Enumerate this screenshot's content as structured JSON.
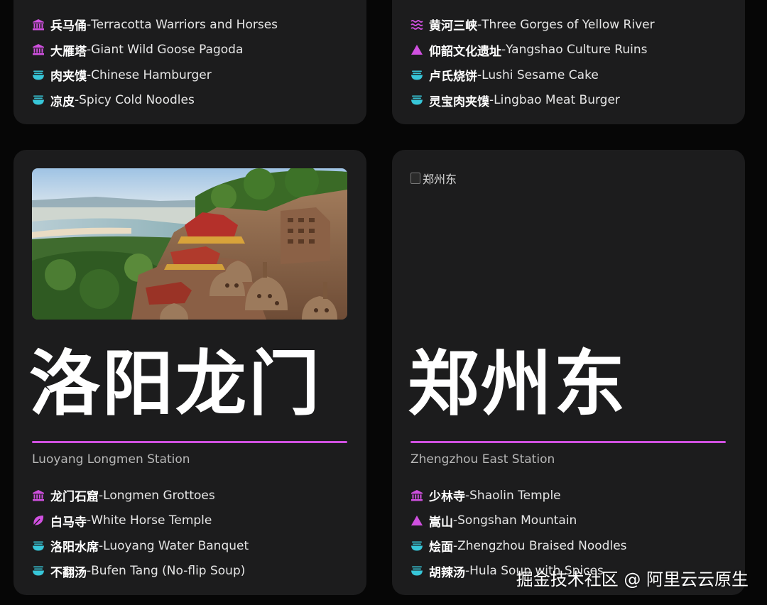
{
  "colors": {
    "accent": "#d050e0",
    "food_icon": "#37c6d8",
    "card_bg": "#1c1c1d",
    "page_bg": "#060606"
  },
  "cards": [
    {
      "items": [
        {
          "icon": "landmark-icon",
          "zh": "兵马俑",
          "sep": " - ",
          "en": "Terracotta Warriors and Horses"
        },
        {
          "icon": "landmark-icon",
          "zh": "大雁塔",
          "sep": " - ",
          "en": "Giant Wild Goose Pagoda"
        },
        {
          "icon": "food-bowl-icon",
          "zh": "肉夹馍",
          "sep": " - ",
          "en": "Chinese Hamburger"
        },
        {
          "icon": "food-bowl-icon",
          "zh": "凉皮",
          "sep": " - ",
          "en": "Spicy Cold Noodles"
        }
      ]
    },
    {
      "items": [
        {
          "icon": "water-icon",
          "zh": "黄河三峡",
          "sep": " - ",
          "en": "Three Gorges of Yellow River"
        },
        {
          "icon": "mountain-icon",
          "zh": "仰韶文化遗址",
          "sep": " - ",
          "en": "Yangshao Culture Ruins"
        },
        {
          "icon": "food-bowl-icon",
          "zh": "卢氏烧饼",
          "sep": " - ",
          "en": "Lushi Sesame Cake"
        },
        {
          "icon": "food-bowl-icon",
          "zh": "灵宝肉夹馍",
          "sep": " - ",
          "en": "Lingbao Meat Burger"
        }
      ]
    },
    {
      "title": "洛阳龙门",
      "subtitle": "Luoyang Longmen Station",
      "items": [
        {
          "icon": "landmark-icon",
          "zh": "龙门石窟",
          "sep": " - ",
          "en": "Longmen Grottoes"
        },
        {
          "icon": "leaf-icon",
          "zh": "白马寺",
          "sep": " - ",
          "en": "White Horse Temple"
        },
        {
          "icon": "food-bowl-icon",
          "zh": "洛阳水席",
          "sep": " - ",
          "en": "Luoyang Water Banquet"
        },
        {
          "icon": "food-bowl-icon",
          "zh": "不翻汤",
          "sep": " - ",
          "en": "Bufen Tang (No-flip Soup)"
        }
      ]
    },
    {
      "image_alt": "郑州东",
      "title": "郑州东",
      "subtitle": "Zhengzhou East Station",
      "items": [
        {
          "icon": "landmark-icon",
          "zh": "少林寺",
          "sep": " - ",
          "en": "Shaolin Temple"
        },
        {
          "icon": "mountain-icon",
          "zh": "嵩山",
          "sep": " - ",
          "en": "Songshan Mountain"
        },
        {
          "icon": "food-bowl-icon",
          "zh": "烩面",
          "sep": " - ",
          "en": "Zhengzhou Braised Noodles"
        },
        {
          "icon": "food-bowl-icon",
          "zh": "胡辣汤",
          "sep": " - ",
          "en": "Hula Soup with Spices"
        }
      ]
    }
  ],
  "watermark": "掘金技术社区 @ 阿里云云原生"
}
